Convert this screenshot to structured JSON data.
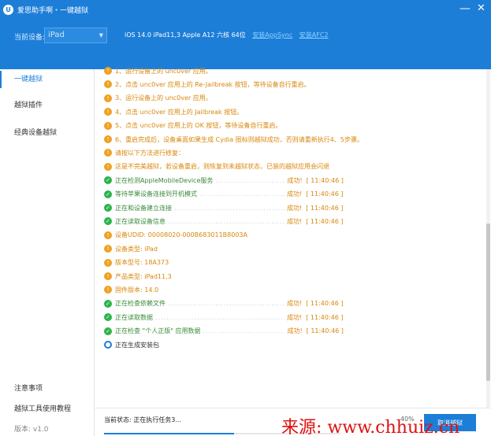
{
  "window": {
    "title": "爱思助手啊・一键越狱",
    "minimize": "—",
    "close": "✕"
  },
  "device": {
    "label": "当前设备:",
    "selected": "iPad",
    "info": "iOS 14.0  iPad11,3  Apple A12 六核 64位",
    "link1": "安装AppSync",
    "link2": "安装AFC2"
  },
  "sidebar": {
    "items": [
      {
        "label": "一键越狱"
      },
      {
        "label": "越狱插件"
      },
      {
        "label": "经典设备越狱"
      }
    ],
    "bottom": [
      {
        "label": "注意事项"
      },
      {
        "label": "越狱工具使用教程"
      },
      {
        "label": "版本: v1.0"
      }
    ]
  },
  "log": [
    {
      "type": "warn",
      "text": "1、运行设备上的 unc0ver 应用。"
    },
    {
      "type": "warn",
      "text": "2、点击 unc0ver 应用上的 Re-Jailbreak 按钮，等待设备自行重启。"
    },
    {
      "type": "warn",
      "text": "3、运行设备上的 unc0ver 应用。"
    },
    {
      "type": "warn",
      "text": "4、点击 unc0ver 应用上的 Jailbreak 按钮。"
    },
    {
      "type": "warn",
      "text": "5、点击 unc0ver 应用上的 OK 按钮，等待设备自行重启。"
    },
    {
      "type": "warn",
      "text": "6、重启完成后，设备桌面如果生成 Cydia 图标则越狱成功，否则请重新执行4、5步骤。"
    },
    {
      "type": "warn",
      "text": "请按以下方法进行修复："
    },
    {
      "type": "warn",
      "text": "这是不完美越狱，若设备重启，则恢复到未越狱状态，已装的越狱应用会闪退"
    },
    {
      "type": "ok",
      "text": "正在检测AppleMobileDevice服务",
      "result": "成功!",
      "time": "[ 11:40:46 ]"
    },
    {
      "type": "ok",
      "text": "等待苹果设备连接到开机模式",
      "result": "成功!",
      "time": "[ 11:40:46 ]"
    },
    {
      "type": "ok",
      "text": "正在和设备建立连接",
      "result": "成功!",
      "time": "[ 11:40:46 ]"
    },
    {
      "type": "ok",
      "text": "正在读取设备信息",
      "result": "成功!",
      "time": "[ 11:40:46 ]"
    },
    {
      "type": "warn",
      "text": "设备UDID: 00008020-000B683011B8003A"
    },
    {
      "type": "warn",
      "text": "设备类型: iPad"
    },
    {
      "type": "warn",
      "text": "版本型号: 18A373"
    },
    {
      "type": "warn",
      "text": "产品类型: iPad11,3"
    },
    {
      "type": "warn",
      "text": "固件版本: 14.0"
    },
    {
      "type": "ok",
      "text": "正在检查依赖文件",
      "result": "成功!",
      "time": "[ 11:40:46 ]"
    },
    {
      "type": "ok",
      "text": "正在读取数据",
      "result": "成功!",
      "time": "[ 11:40:46 ]"
    },
    {
      "type": "ok",
      "text": "正在检查 \"个人正版\" 应用数据",
      "result": "成功!",
      "time": "[ 11:40:46 ]"
    },
    {
      "type": "run",
      "text": "正在生成安装包"
    }
  ],
  "status": {
    "text": "当前状态: 正在执行任务3...",
    "percent": "40%",
    "progress": 0.55,
    "cancel": "取消越狱"
  },
  "watermark": "来源:  www.chhuiz.cn"
}
